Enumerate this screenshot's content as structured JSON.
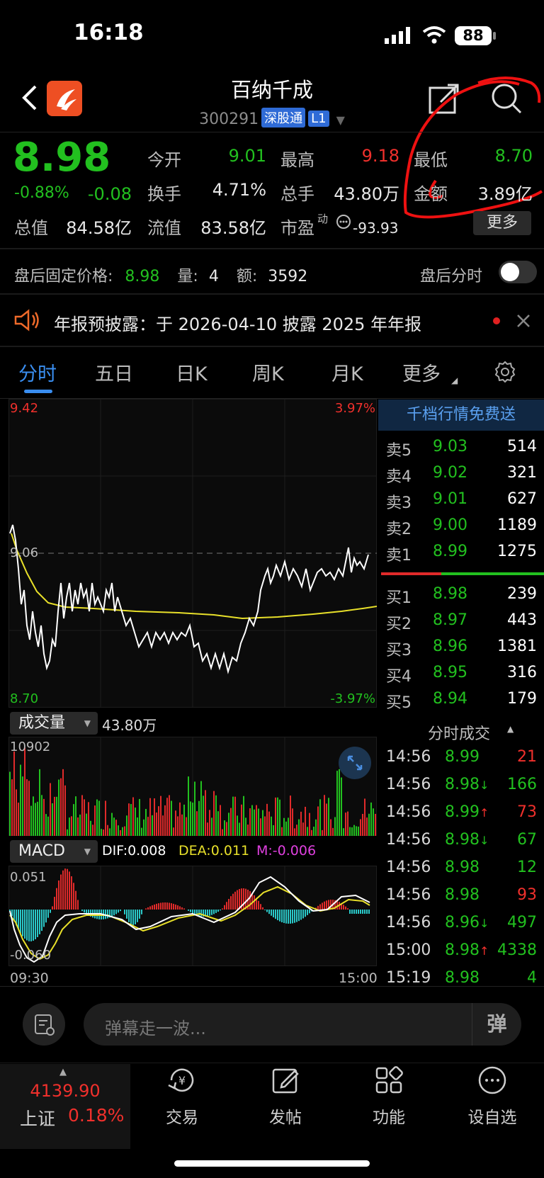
{
  "status": {
    "time": "16:18",
    "battery": "88"
  },
  "nav": {
    "title": "百纳千成",
    "code": "300291",
    "tag1": "深股通",
    "tag2": "L1"
  },
  "quote": {
    "price": "8.98",
    "pct": "-0.88%",
    "chg": "-0.08",
    "open_label": "今开",
    "open": "9.01",
    "high_label": "最高",
    "high": "9.18",
    "low_label": "最低",
    "low": "8.70",
    "turnover_label": "换手",
    "turnover": "4.71%",
    "volume_label": "总手",
    "volume": "43.80万",
    "amount_label": "金额",
    "amount": "3.89亿",
    "mcap_label": "总值",
    "mcap": "84.58亿",
    "float_label": "流值",
    "float": "83.58亿",
    "pe_label": "市盈",
    "pe_sup": "动",
    "pe": "-93.93",
    "more_label": "更多"
  },
  "afterhours": {
    "label": "盘后固定价格:",
    "price": "8.98",
    "vol_label": "量:",
    "vol": "4",
    "amt_label": "额:",
    "amt": "3592",
    "toggle_label": "盘后分时"
  },
  "notice": {
    "text": "年报预披露：于 2026-04-10 披露 2025 年年报"
  },
  "tabs": [
    "分时",
    "五日",
    "日K",
    "周K",
    "月K",
    "更多"
  ],
  "chart": {
    "top_price": "9.42",
    "top_pct": "3.97%",
    "mid_price": "9.06",
    "bot_price": "8.70",
    "bot_pct": "-3.97%",
    "vol_selector": "成交量",
    "vol_total": "43.80万",
    "vol_max": "10902",
    "macd_selector": "MACD",
    "dif": "DIF:0.008",
    "dea": "DEA:0.011",
    "m": "M:-0.006",
    "macd_top": "0.051",
    "macd_bot": "-0.060",
    "time_start": "09:30",
    "time_end": "15:00"
  },
  "orderbook": {
    "banner": "千档行情免费送",
    "asks": [
      {
        "k": "卖5",
        "p": "9.03",
        "v": "514"
      },
      {
        "k": "卖4",
        "p": "9.02",
        "v": "321"
      },
      {
        "k": "卖3",
        "p": "9.01",
        "v": "627"
      },
      {
        "k": "卖2",
        "p": "9.00",
        "v": "1189"
      },
      {
        "k": "卖1",
        "p": "8.99",
        "v": "1275"
      }
    ],
    "bids": [
      {
        "k": "买1",
        "p": "8.98",
        "v": "239"
      },
      {
        "k": "买2",
        "p": "8.97",
        "v": "443"
      },
      {
        "k": "买3",
        "p": "8.96",
        "v": "1381"
      },
      {
        "k": "买4",
        "p": "8.95",
        "v": "316"
      },
      {
        "k": "买5",
        "p": "8.94",
        "v": "179"
      }
    ]
  },
  "trades": {
    "title": "分时成交",
    "rows": [
      {
        "t": "14:56",
        "p": "8.99",
        "a": "",
        "v": "21",
        "pc": "g",
        "vc": "r"
      },
      {
        "t": "14:56",
        "p": "8.98",
        "a": "↓",
        "v": "166",
        "pc": "g",
        "vc": "g"
      },
      {
        "t": "14:56",
        "p": "8.99",
        "a": "↑",
        "v": "73",
        "pc": "g",
        "vc": "r"
      },
      {
        "t": "14:56",
        "p": "8.98",
        "a": "↓",
        "v": "67",
        "pc": "g",
        "vc": "g"
      },
      {
        "t": "14:56",
        "p": "8.98",
        "a": "",
        "v": "12",
        "pc": "g",
        "vc": "g"
      },
      {
        "t": "14:56",
        "p": "8.98",
        "a": "",
        "v": "93",
        "pc": "g",
        "vc": "r"
      },
      {
        "t": "14:56",
        "p": "8.96",
        "a": "↓",
        "v": "497",
        "pc": "g",
        "vc": "g"
      },
      {
        "t": "15:00",
        "p": "8.98",
        "a": "↑",
        "v": "4338",
        "pc": "g",
        "vc": "g"
      },
      {
        "t": "15:19",
        "p": "8.98",
        "a": "",
        "v": "4",
        "pc": "g",
        "vc": "g"
      }
    ]
  },
  "danmu": {
    "placeholder": "弹幕走一波...",
    "send": "弹"
  },
  "bottom": {
    "index_value": "4139.90",
    "index_name": "上证",
    "index_pct": "0.18%",
    "trade": "交易",
    "post": "发帖",
    "func": "功能",
    "watch": "设自选"
  }
}
